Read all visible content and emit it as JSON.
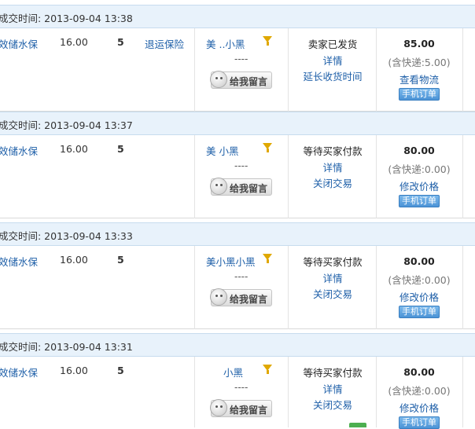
{
  "orders": [
    {
      "header": "成交时间: 2013-09-04 13:38",
      "item": "效储水保",
      "price": "16.00",
      "qty": "5",
      "service": "退运保险",
      "buyer": "美 ..小黑",
      "buyer_sub": "----",
      "msg_btn": "给我留言",
      "status": "卖家已发货",
      "detail": "详情",
      "action": "延长收货时间",
      "total": "85.00",
      "shipping": "(含快递:5.00)",
      "action2": "查看物流",
      "mobile": "手机订单"
    },
    {
      "header": "成交时间: 2013-09-04 13:37",
      "item": "效储水保",
      "price": "16.00",
      "qty": "5",
      "service": "",
      "buyer": "美 小黑",
      "buyer_sub": "----",
      "msg_btn": "给我留言",
      "status": "等待买家付款",
      "detail": "详情",
      "action": "关闭交易",
      "total": "80.00",
      "shipping": "(含快递:0.00)",
      "action2": "修改价格",
      "mobile": "手机订单"
    },
    {
      "header": "成交时间: 2013-09-04 13:33",
      "item": "效储水保",
      "price": "16.00",
      "qty": "5",
      "service": "",
      "buyer": "美小黑小黑",
      "buyer_sub": "----",
      "msg_btn": "给我留言",
      "status": "等待买家付款",
      "detail": "详情",
      "action": "关闭交易",
      "total": "80.00",
      "shipping": "(含快递:0.00)",
      "action2": "修改价格",
      "mobile": "手机订单"
    },
    {
      "header": "成交时间: 2013-09-04 13:31",
      "item": "效储水保",
      "price": "16.00",
      "qty": "5",
      "service": "",
      "buyer": "小黑",
      "buyer_sub": "----",
      "msg_btn": "给我留言",
      "status": "等待买家付款",
      "detail": "详情",
      "action": "关闭交易",
      "total": "80.00",
      "shipping": "(含快递:0.00)",
      "action2": "修改价格",
      "mobile": "手机订单"
    }
  ],
  "colors": {
    "header_bg": "#e8f2fb",
    "link": "#1e5fa8",
    "mobile_badge": "#4b93d6"
  }
}
